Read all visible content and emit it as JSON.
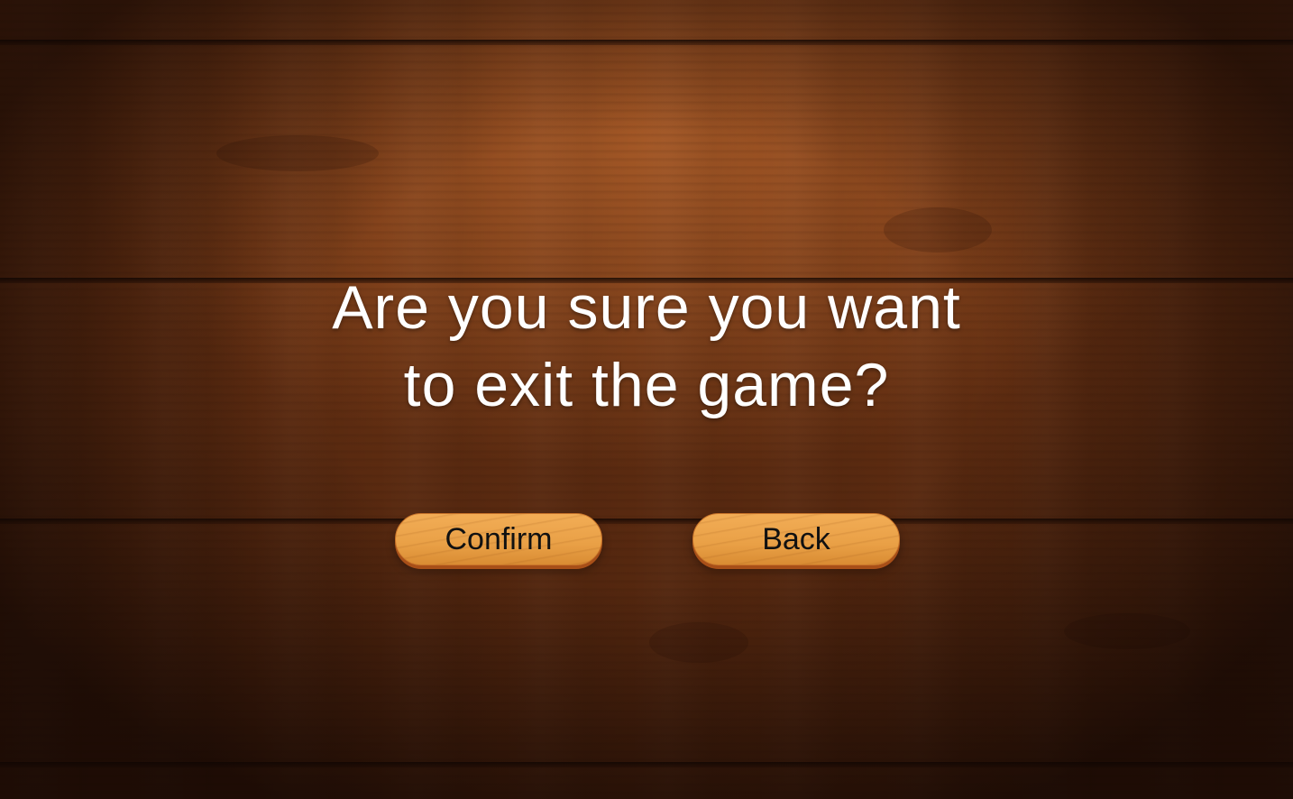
{
  "dialog": {
    "message_line1": "Are you sure you want",
    "message_line2": "to exit the game?",
    "confirm_label": "Confirm",
    "back_label": "Back"
  },
  "colors": {
    "background_wood": "#5a2a10",
    "message_text": "#ffffff",
    "button_fill": "#e9a046",
    "button_shadow": "#a84f18",
    "button_text": "#111111"
  }
}
